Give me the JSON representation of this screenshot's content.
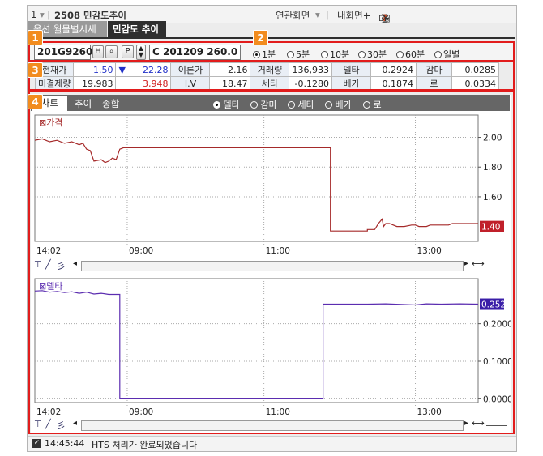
{
  "window": {
    "screen_num": "1",
    "screen_code": "2508 민감도추이",
    "related_menu": "연관화면",
    "my_screen": "내화면+",
    "help_icon": "?"
  },
  "tabs": [
    "옵션 월물별시세",
    "민감도 추이"
  ],
  "badges": [
    "1",
    "2",
    "3",
    "4"
  ],
  "controls": {
    "code": "201G9260",
    "h_btn": "H",
    "p_btn": "P",
    "option_name": "C 201209 260.0",
    "intervals": [
      "1분",
      "5분",
      "10분",
      "30분",
      "60분",
      "일별"
    ],
    "selected_interval": "1분"
  },
  "info": {
    "row1": [
      {
        "label": "현재가",
        "value": "1.50"
      },
      {
        "label": "",
        "value": "22.28",
        "arrow": "▼"
      },
      {
        "label": "이론가",
        "value": "2.16"
      },
      {
        "label": "거래량",
        "value": "136,933"
      },
      {
        "label": "델타",
        "value": "0.2924"
      },
      {
        "label": "감마",
        "value": "0.0285"
      }
    ],
    "row2": [
      {
        "label": "미결제량",
        "value": "19,983"
      },
      {
        "label": "",
        "value": "3,948"
      },
      {
        "label": "I.V",
        "value": "18.47"
      },
      {
        "label": "세타",
        "value": "-0.1280"
      },
      {
        "label": "베가",
        "value": "0.1874"
      },
      {
        "label": "로",
        "value": "0.0334"
      }
    ]
  },
  "sub_tabs": [
    "차트",
    "추이",
    "종합"
  ],
  "greeks": [
    "델타",
    "감마",
    "세타",
    "베가",
    "로"
  ],
  "selected_greek": "델타",
  "colors": {
    "price": "#a52a2a",
    "delta": "#5b2db0",
    "price_badge": "#c0202a",
    "delta_badge": "#3a1ea8",
    "frame": "#e21c1c",
    "badge": "#f28c1e"
  },
  "chart_data": [
    {
      "type": "line",
      "title": "가격",
      "x_ticks": [
        "14:02",
        "09:00",
        "11:00",
        "13:00"
      ],
      "y_ticks": [
        "2.00",
        "1.80",
        "1.60"
      ],
      "ylim": [
        1.3,
        2.15
      ],
      "last_value": "1.40",
      "series": [
        {
          "values": [
            [
              0,
              1.98
            ],
            [
              2,
              1.99
            ],
            [
              4,
              1.97
            ],
            [
              6,
              1.98
            ],
            [
              8,
              1.96
            ],
            [
              10,
              1.97
            ],
            [
              12,
              1.95
            ],
            [
              13,
              1.96
            ],
            [
              14,
              1.92
            ],
            [
              15,
              1.91
            ],
            [
              16,
              1.84
            ],
            [
              18,
              1.85
            ],
            [
              19,
              1.83
            ],
            [
              20,
              1.84
            ],
            [
              21,
              1.86
            ],
            [
              22,
              1.85
            ],
            [
              23,
              1.92
            ],
            [
              24,
              1.93
            ],
            [
              28,
              1.93
            ],
            [
              40,
              1.93
            ],
            [
              60,
              1.93
            ],
            [
              75,
              1.93
            ],
            [
              80,
              1.93
            ],
            [
              80,
              1.37
            ],
            [
              86,
              1.37
            ],
            [
              90,
              1.37
            ],
            [
              90,
              1.38
            ],
            [
              92,
              1.38
            ],
            [
              93,
              1.42
            ],
            [
              94,
              1.45
            ],
            [
              94.4,
              1.4
            ],
            [
              95,
              1.42
            ],
            [
              96,
              1.42
            ],
            [
              98,
              1.4
            ],
            [
              100,
              1.4
            ],
            [
              102,
              1.41
            ],
            [
              103,
              1.41
            ],
            [
              104,
              1.4
            ],
            [
              106,
              1.4
            ],
            [
              107,
              1.41
            ],
            [
              112,
              1.41
            ],
            [
              113,
              1.42
            ],
            [
              117,
              1.42
            ],
            [
              120,
              1.42
            ]
          ]
        }
      ]
    },
    {
      "type": "line",
      "title": "델타",
      "x_ticks": [
        "14:02",
        "09:00",
        "11:00",
        "13:00"
      ],
      "y_ticks": [
        "0.2000",
        "0.1000",
        "0.0000"
      ],
      "ylim": [
        -0.01,
        0.32
      ],
      "last_value": "0.2520",
      "series": [
        {
          "values": [
            [
              0,
              0.287
            ],
            [
              2,
              0.288
            ],
            [
              4,
              0.284
            ],
            [
              6,
              0.286
            ],
            [
              8,
              0.283
            ],
            [
              10,
              0.285
            ],
            [
              12,
              0.281
            ],
            [
              14,
              0.284
            ],
            [
              16,
              0.279
            ],
            [
              18,
              0.281
            ],
            [
              20,
              0.278
            ],
            [
              22,
              0.278
            ],
            [
              23,
              0.278
            ],
            [
              23,
              0.0
            ],
            [
              28,
              0.0
            ],
            [
              40,
              0.0
            ],
            [
              60,
              0.0
            ],
            [
              78,
              0.0
            ],
            [
              78,
              0.252
            ],
            [
              85,
              0.252
            ],
            [
              90,
              0.252
            ],
            [
              95,
              0.253
            ],
            [
              100,
              0.251
            ],
            [
              103,
              0.25
            ],
            [
              106,
              0.253
            ],
            [
              110,
              0.252
            ],
            [
              115,
              0.253
            ],
            [
              120,
              0.252
            ]
          ]
        }
      ]
    }
  ],
  "status": {
    "time": "14:45:44",
    "message": "HTS 처리가 완료되었습니다"
  }
}
